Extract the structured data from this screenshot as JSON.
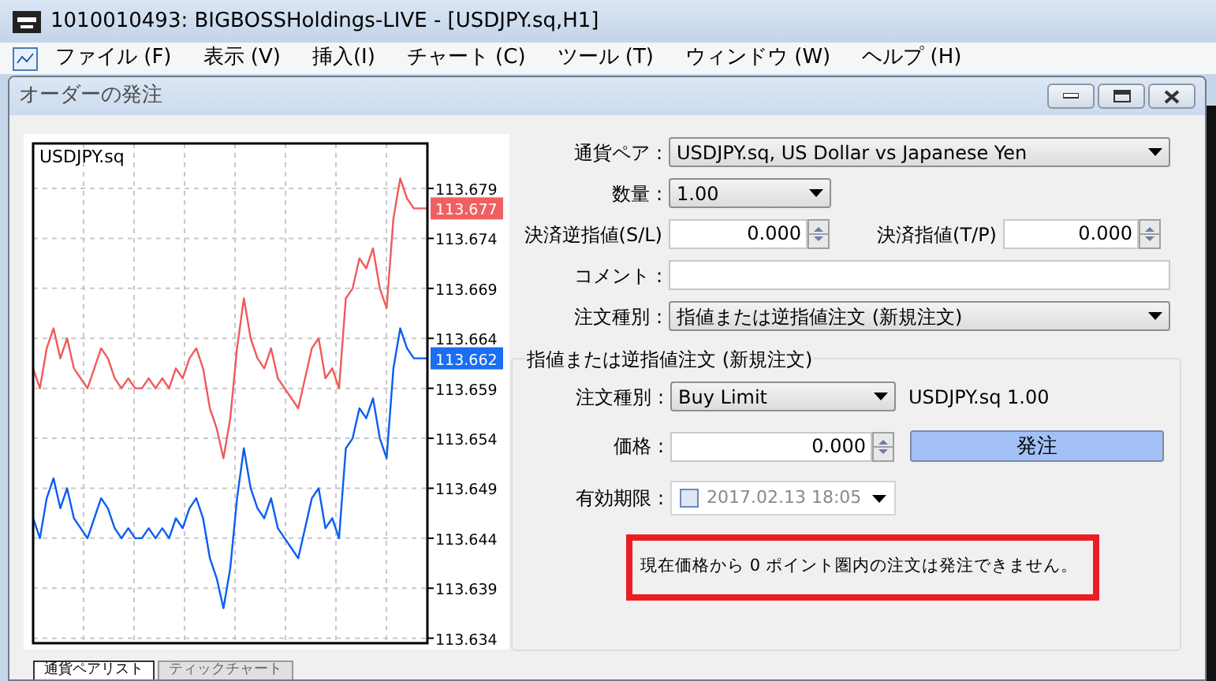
{
  "window": {
    "title": "1010010493: BIGBOSSHoldings-LIVE - [USDJPY.sq,H1]"
  },
  "menu": [
    "ファイル (F)",
    "表示 (V)",
    "挿入(I)",
    "チャート (C)",
    "ツール (T)",
    "ウィンドウ (W)",
    "ヘルプ (H)"
  ],
  "dialog": {
    "title": "オーダーの発注",
    "chart": {
      "symbol": "USDJPY.sq",
      "chart_data": {
        "type": "line",
        "grid": true,
        "ylim": [
          113.6335,
          113.6835
        ],
        "yticks": [
          113.634,
          113.639,
          113.644,
          113.649,
          113.654,
          113.659,
          113.664,
          113.669,
          113.674,
          113.679
        ],
        "series": [
          {
            "color": "#f05a5a",
            "values": [
              113.661,
              113.659,
              113.663,
              113.665,
              113.662,
              113.664,
              113.661,
              113.66,
              113.659,
              113.661,
              113.663,
              113.662,
              113.66,
              113.659,
              113.66,
              113.659,
              113.659,
              113.66,
              113.659,
              113.66,
              113.659,
              113.661,
              113.66,
              113.662,
              113.663,
              113.661,
              113.657,
              113.655,
              113.652,
              113.656,
              113.663,
              113.668,
              113.664,
              113.662,
              113.661,
              113.663,
              113.66,
              113.659,
              113.658,
              113.657,
              113.66,
              113.663,
              113.664,
              113.66,
              113.661,
              113.659,
              113.668,
              113.669,
              113.672,
              113.671,
              113.673,
              113.669,
              113.667,
              113.676,
              113.68,
              113.678,
              113.677,
              113.677,
              113.677
            ]
          },
          {
            "color": "#0a5ef0",
            "values": [
              113.646,
              113.644,
              113.648,
              113.65,
              113.647,
              113.649,
              113.646,
              113.645,
              113.644,
              113.646,
              113.648,
              113.647,
              113.645,
              113.644,
              113.645,
              113.644,
              113.644,
              113.645,
              113.644,
              113.645,
              113.644,
              113.646,
              113.645,
              113.647,
              113.648,
              113.646,
              113.642,
              113.64,
              113.637,
              113.641,
              113.648,
              113.653,
              113.649,
              113.647,
              113.646,
              113.648,
              113.645,
              113.644,
              113.643,
              113.642,
              113.645,
              113.648,
              113.649,
              113.645,
              113.646,
              113.644,
              113.653,
              113.654,
              113.657,
              113.656,
              113.658,
              113.654,
              113.652,
              113.661,
              113.665,
              113.663,
              113.662,
              113.662,
              113.662
            ]
          }
        ]
      },
      "price_tags": [
        {
          "text": "113.677",
          "color": "#f06060"
        },
        {
          "text": "113.662",
          "color": "#1a6ef0"
        }
      ]
    },
    "symbol": {
      "label": "通貨ペア :",
      "value": "USDJPY.sq, US Dollar vs Japanese Yen"
    },
    "volume": {
      "label": "数量 :",
      "value": "1.00"
    },
    "stop_loss": {
      "label": "決済逆指値(S/L)",
      "value": "0.000"
    },
    "take_profit": {
      "label": "決済指値(T/P)",
      "value": "0.000"
    },
    "comment": {
      "label": "コメント :"
    },
    "order_type": {
      "label": "注文種別 :",
      "value": "指値または逆指値注文 (新規注文)"
    },
    "pending": {
      "title": "指値または逆指値注文 (新規注文)",
      "order_type": {
        "label": "注文種別 :",
        "value": "Buy Limit"
      },
      "summary": "USDJPY.sq 1.00",
      "price": {
        "label": "価格 :",
        "value": "0.000"
      },
      "place_button": "発注",
      "expiry": {
        "label": "有効期限 :",
        "checked": false,
        "value": "2017.02.13 18:05"
      },
      "message": "現在価格から 0 ポイント圏内の注文は発注できません。"
    }
  },
  "bottom_tabs": [
    {
      "label": "通貨ペアリスト",
      "selected": true
    },
    {
      "label": "ティックチャート",
      "selected": false
    }
  ]
}
